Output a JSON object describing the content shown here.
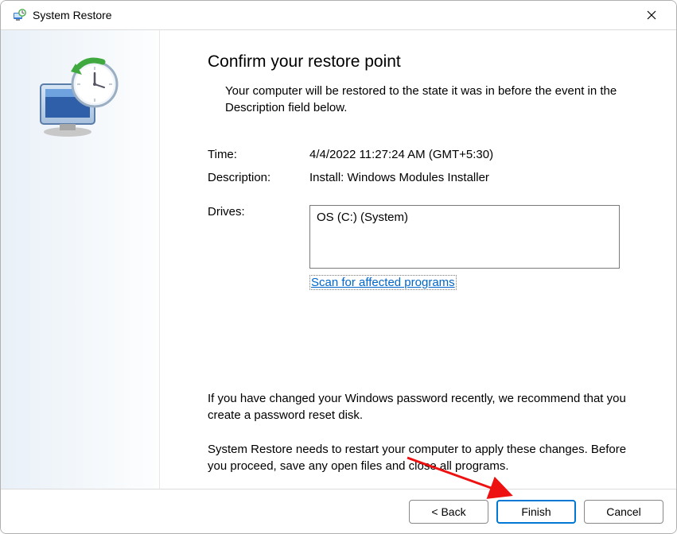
{
  "titlebar": {
    "title": "System Restore"
  },
  "heading": "Confirm your restore point",
  "subtitle": "Your computer will be restored to the state it was in before the event in the Description field below.",
  "info": {
    "time_label": "Time:",
    "time_value": "4/4/2022 11:27:24 AM (GMT+5:30)",
    "description_label": "Description:",
    "description_value": "Install: Windows Modules Installer",
    "drives_label": "Drives:",
    "drives_value": "OS (C:) (System)"
  },
  "scan_link": "Scan for affected programs",
  "warning1": "If you have changed your Windows password recently, we recommend that you create a password reset disk.",
  "warning2": "System Restore needs to restart your computer to apply these changes. Before you proceed, save any open files and close all programs.",
  "buttons": {
    "back": "< Back",
    "finish": "Finish",
    "cancel": "Cancel"
  }
}
